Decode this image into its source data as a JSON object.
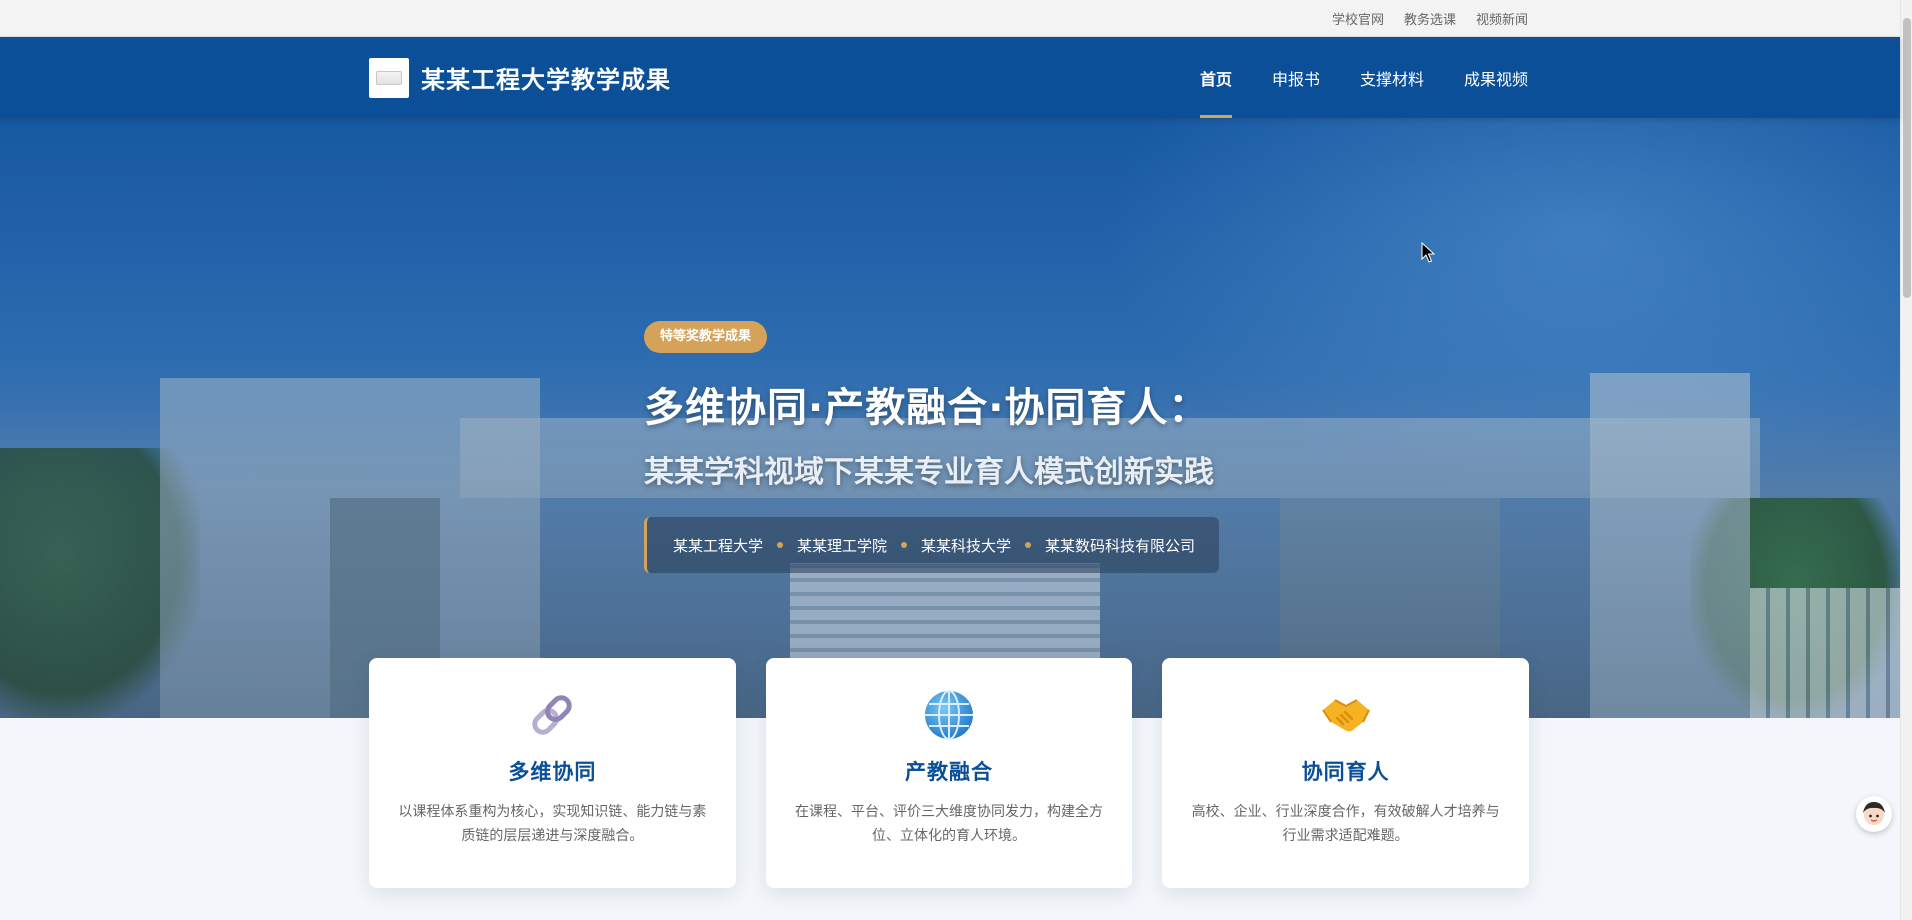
{
  "utility_links": [
    "学校官网",
    "教务选课",
    "视频新闻"
  ],
  "brand": {
    "name": "某某工程大学教学成果"
  },
  "nav": [
    {
      "label": "首页",
      "active": true
    },
    {
      "label": "申报书",
      "active": false
    },
    {
      "label": "支撑材料",
      "active": false
    },
    {
      "label": "成果视频",
      "active": false
    }
  ],
  "hero": {
    "badge": "特等奖教学成果",
    "title": "多维协同·产教融合·协同育人：",
    "subtitle": "某某学科视域下某某专业育人模式创新实践",
    "orgs": [
      "某某工程大学",
      "某某理工学院",
      "某某科技大学",
      "某某数码科技有限公司"
    ]
  },
  "cards": [
    {
      "icon": "chain-link-icon",
      "title": "多维协同",
      "desc": "以课程体系重构为核心，实现知识链、能力链与素质链的层层递进与深度融合。"
    },
    {
      "icon": "globe-icon",
      "title": "产教融合",
      "desc": "在课程、平台、评价三大维度协同发力，构建全方位、立体化的育人环境。"
    },
    {
      "icon": "handshake-icon",
      "title": "协同育人",
      "desc": "高校、企业、行业深度合作，有效破解人才培养与行业需求适配难题。"
    }
  ],
  "colors": {
    "primary": "#0a4f98",
    "accent": "#d4a259",
    "background": "#f3f6fa"
  }
}
